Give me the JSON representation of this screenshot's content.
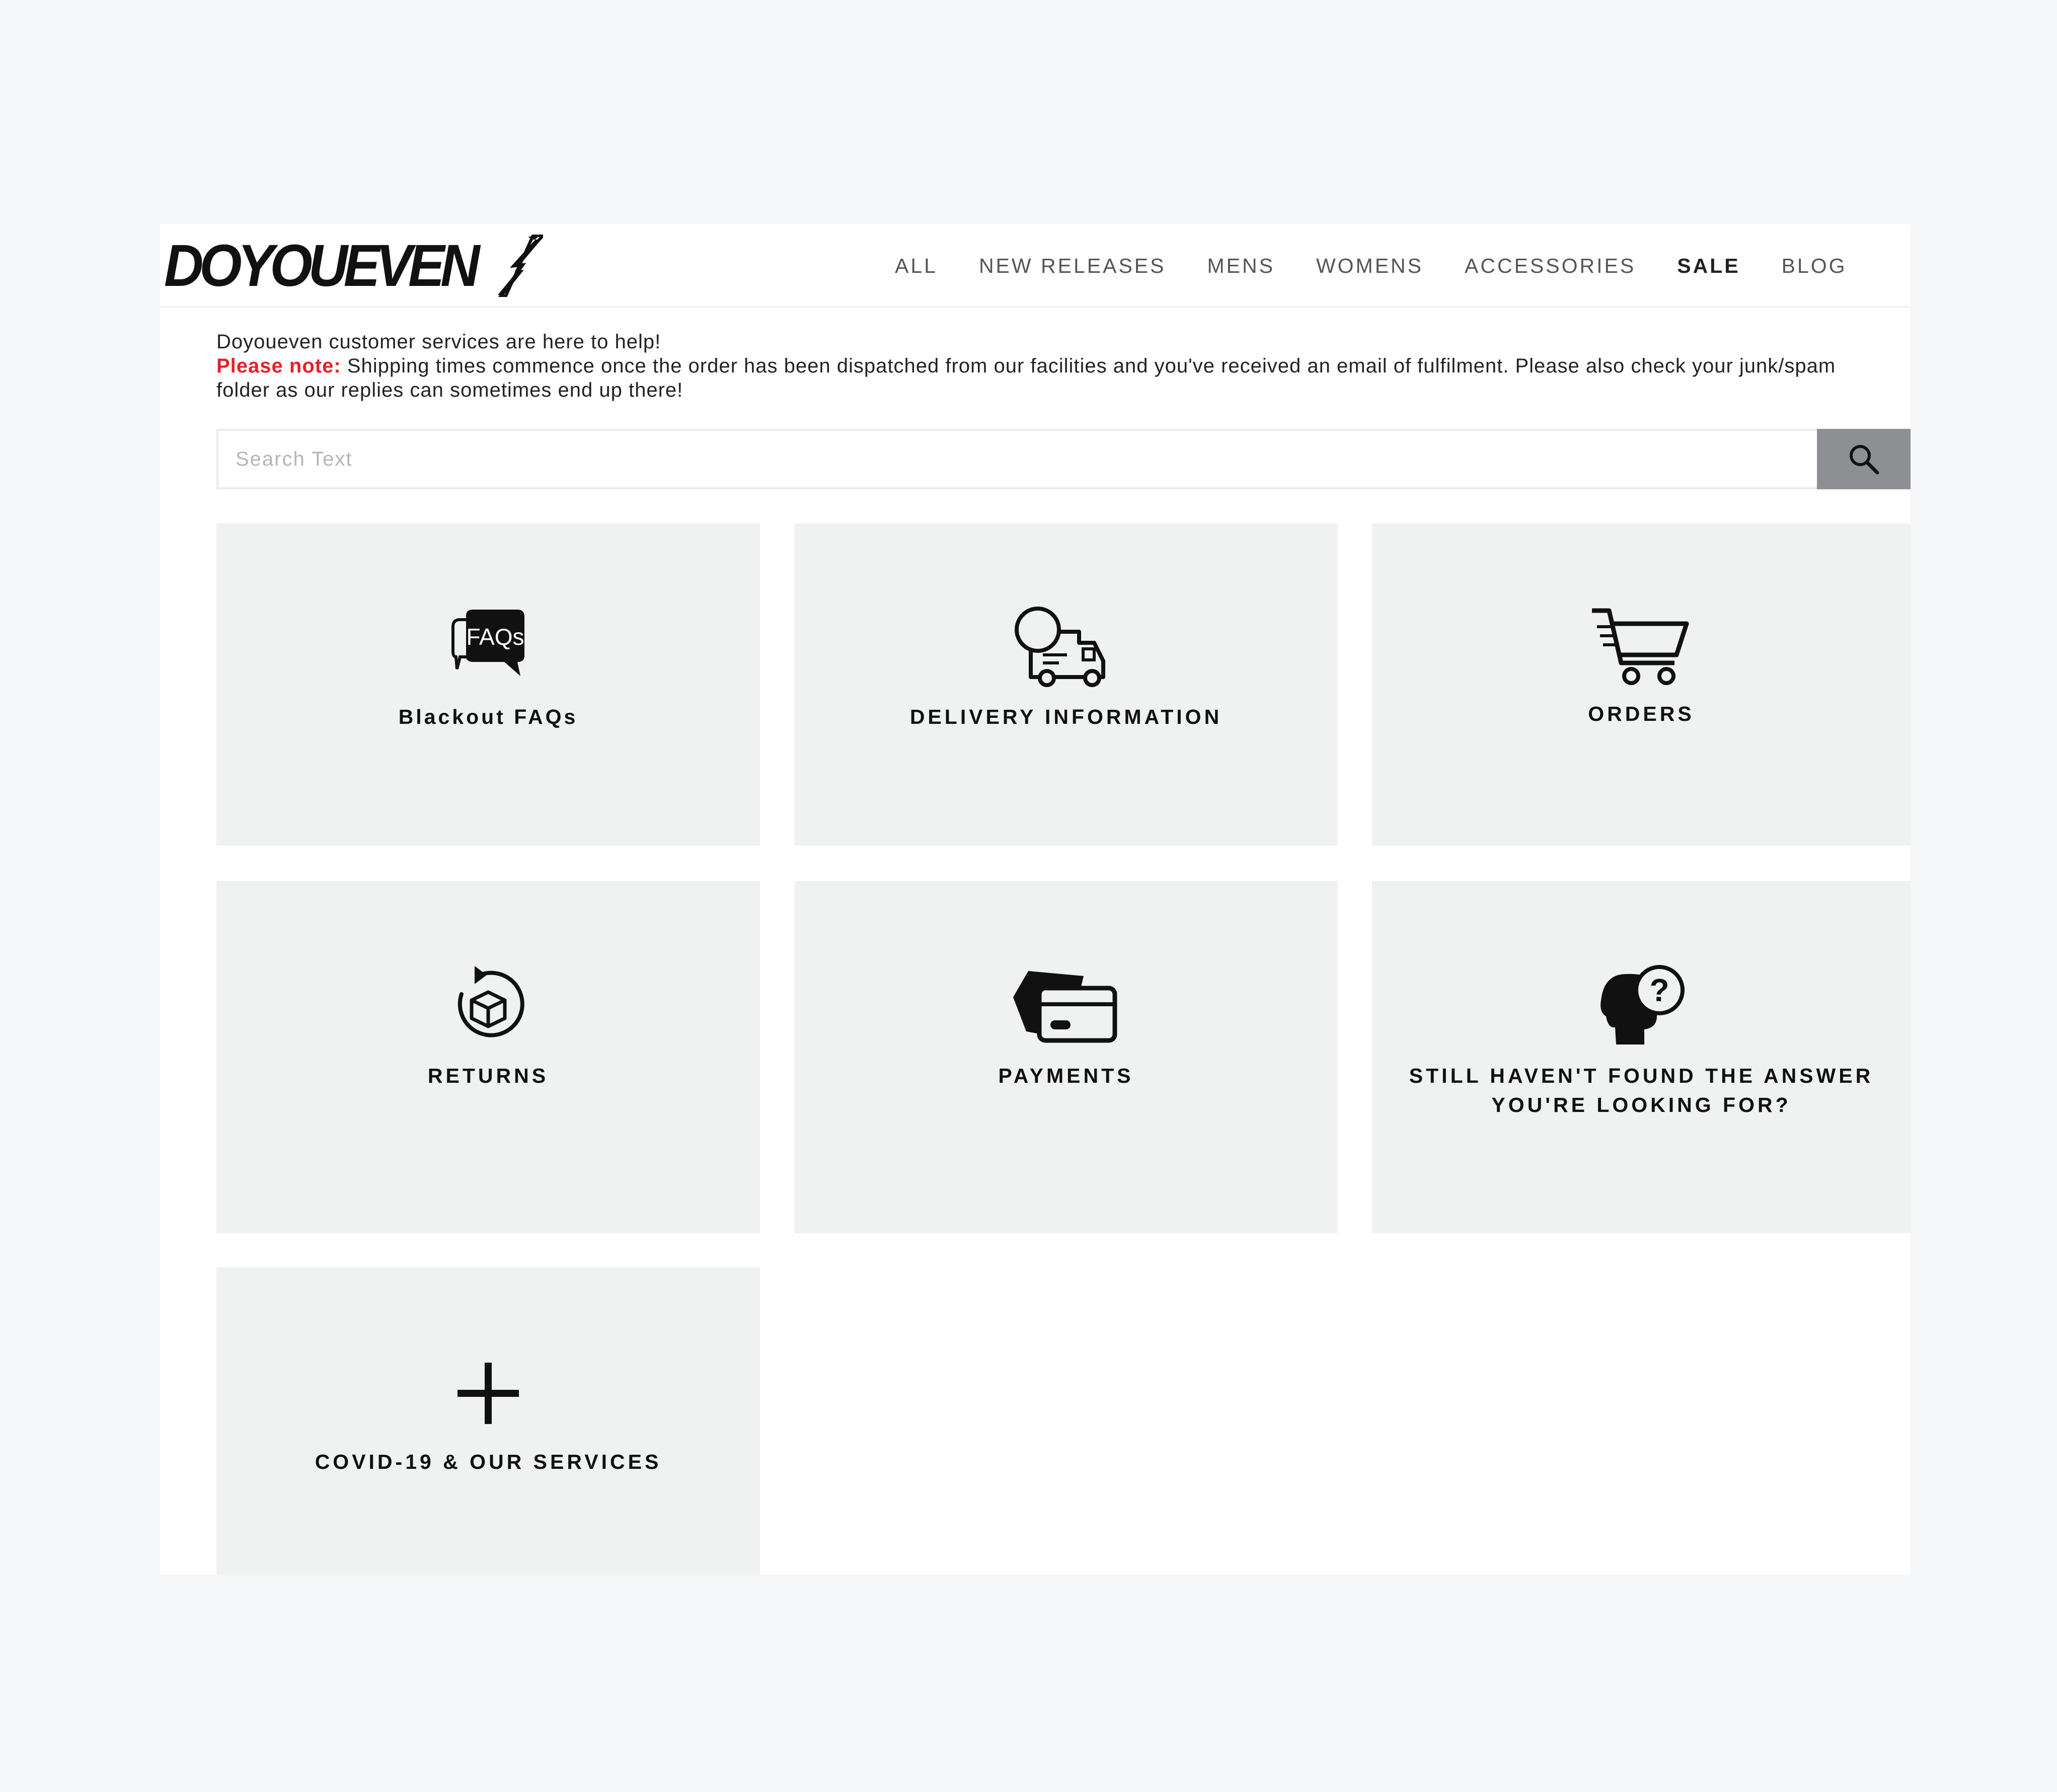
{
  "brand": {
    "logo_text": "DOYOUEVEN"
  },
  "nav": {
    "items": [
      {
        "label": "ALL",
        "bold": false
      },
      {
        "label": "NEW RELEASES",
        "bold": false
      },
      {
        "label": "MENS",
        "bold": false
      },
      {
        "label": "WOMENS",
        "bold": false
      },
      {
        "label": "ACCESSORIES",
        "bold": false
      },
      {
        "label": "SALE",
        "bold": true
      },
      {
        "label": "BLOG",
        "bold": false
      }
    ]
  },
  "notice": {
    "intro": "Doyoueven customer services are here to help!",
    "note_label": "Please note:",
    "note_text": " Shipping times commence once the order has been dispatched from our facilities and you've received an email of fulfilment. Please also check your junk/spam folder as our replies can sometimes end up there!"
  },
  "search": {
    "placeholder": "Search Text",
    "value": "",
    "icon": "search-icon"
  },
  "tiles": [
    {
      "label": "Blackout FAQs",
      "icon": "faq-bubble-icon"
    },
    {
      "label": "DELIVERY INFORMATION",
      "icon": "delivery-truck-icon"
    },
    {
      "label": "ORDERS",
      "icon": "shopping-cart-icon"
    },
    {
      "label": "RETURNS",
      "icon": "return-box-icon"
    },
    {
      "label": "PAYMENTS",
      "icon": "credit-card-icon"
    },
    {
      "label": "STILL HAVEN'T FOUND THE ANSWER YOU'RE LOOKING FOR?",
      "icon": "head-question-icon"
    },
    {
      "label": "COVID-19 & OUR SERVICES",
      "icon": "plus-icon"
    }
  ],
  "colors": {
    "accent_red": "#e4202c",
    "tile_bg": "#f0f1f1",
    "search_button_bg": "#8e8f93"
  }
}
